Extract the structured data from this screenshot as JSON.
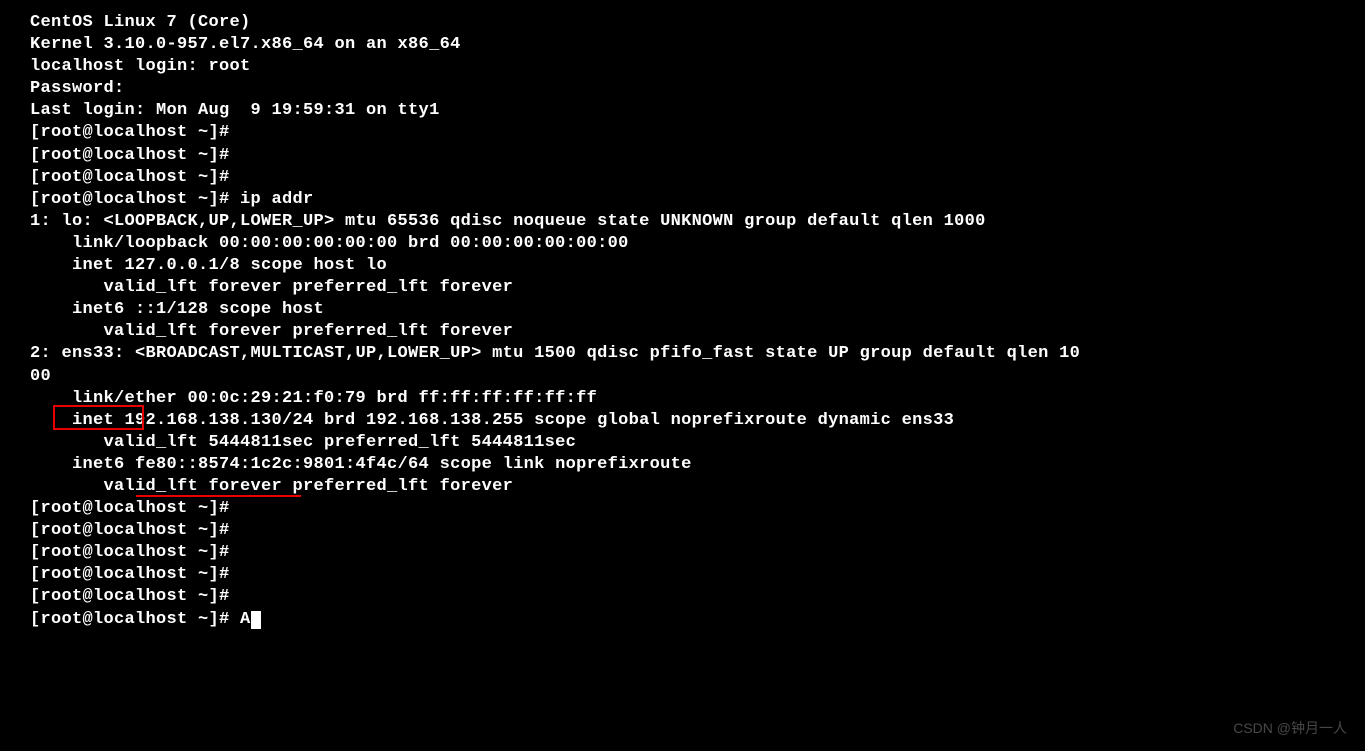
{
  "lines": {
    "l1": "CentOS Linux 7 (Core)",
    "l2": "Kernel 3.10.0-957.el7.x86_64 on an x86_64",
    "l3": "",
    "l4": "localhost login: root",
    "l5": "Password:",
    "l6": "Last login: Mon Aug  9 19:59:31 on tty1",
    "l7": "[root@localhost ~]#",
    "l8": "[root@localhost ~]#",
    "l9": "[root@localhost ~]#",
    "l10": "[root@localhost ~]# ip addr",
    "l11": "1: lo: <LOOPBACK,UP,LOWER_UP> mtu 65536 qdisc noqueue state UNKNOWN group default qlen 1000",
    "l12": "    link/loopback 00:00:00:00:00:00 brd 00:00:00:00:00:00",
    "l13": "    inet 127.0.0.1/8 scope host lo",
    "l14": "       valid_lft forever preferred_lft forever",
    "l15": "    inet6 ::1/128 scope host",
    "l16": "       valid_lft forever preferred_lft forever",
    "l17": "2: ens33: <BROADCAST,MULTICAST,UP,LOWER_UP> mtu 1500 qdisc pfifo_fast state UP group default qlen 10",
    "l18": "00",
    "l19": "    link/ether 00:0c:29:21:f0:79 brd ff:ff:ff:ff:ff:ff",
    "l20": "    inet 192.168.138.130/24 brd 192.168.138.255 scope global noprefixroute dynamic ens33",
    "l21": "       valid_lft 5444811sec preferred_lft 5444811sec",
    "l22": "    inet6 fe80::8574:1c2c:9801:4f4c/64 scope link noprefixroute",
    "l23": "       valid_lft forever preferred_lft forever",
    "l24": "[root@localhost ~]#",
    "l25": "[root@localhost ~]#",
    "l26": "[root@localhost ~]#",
    "l27": "[root@localhost ~]#",
    "l28": "[root@localhost ~]#",
    "l29": "[root@localhost ~]# A"
  },
  "watermark": "CSDN @钟月一人",
  "highlights": {
    "interface_name": "ens33:",
    "ip_address": "192.168.138.130"
  }
}
